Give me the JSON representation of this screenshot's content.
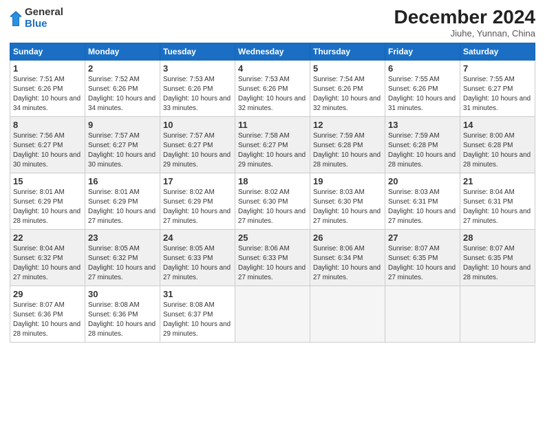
{
  "logo": {
    "general": "General",
    "blue": "Blue"
  },
  "title": "December 2024",
  "location": "Jiuhe, Yunnan, China",
  "days_of_week": [
    "Sunday",
    "Monday",
    "Tuesday",
    "Wednesday",
    "Thursday",
    "Friday",
    "Saturday"
  ],
  "weeks": [
    [
      {
        "num": "1",
        "rise": "7:51 AM",
        "set": "6:26 PM",
        "daylight": "10 hours and 34 minutes."
      },
      {
        "num": "2",
        "rise": "7:52 AM",
        "set": "6:26 PM",
        "daylight": "10 hours and 34 minutes."
      },
      {
        "num": "3",
        "rise": "7:53 AM",
        "set": "6:26 PM",
        "daylight": "10 hours and 33 minutes."
      },
      {
        "num": "4",
        "rise": "7:53 AM",
        "set": "6:26 PM",
        "daylight": "10 hours and 32 minutes."
      },
      {
        "num": "5",
        "rise": "7:54 AM",
        "set": "6:26 PM",
        "daylight": "10 hours and 32 minutes."
      },
      {
        "num": "6",
        "rise": "7:55 AM",
        "set": "6:26 PM",
        "daylight": "10 hours and 31 minutes."
      },
      {
        "num": "7",
        "rise": "7:55 AM",
        "set": "6:27 PM",
        "daylight": "10 hours and 31 minutes."
      }
    ],
    [
      {
        "num": "8",
        "rise": "7:56 AM",
        "set": "6:27 PM",
        "daylight": "10 hours and 30 minutes."
      },
      {
        "num": "9",
        "rise": "7:57 AM",
        "set": "6:27 PM",
        "daylight": "10 hours and 30 minutes."
      },
      {
        "num": "10",
        "rise": "7:57 AM",
        "set": "6:27 PM",
        "daylight": "10 hours and 29 minutes."
      },
      {
        "num": "11",
        "rise": "7:58 AM",
        "set": "6:27 PM",
        "daylight": "10 hours and 29 minutes."
      },
      {
        "num": "12",
        "rise": "7:59 AM",
        "set": "6:28 PM",
        "daylight": "10 hours and 28 minutes."
      },
      {
        "num": "13",
        "rise": "7:59 AM",
        "set": "6:28 PM",
        "daylight": "10 hours and 28 minutes."
      },
      {
        "num": "14",
        "rise": "8:00 AM",
        "set": "6:28 PM",
        "daylight": "10 hours and 28 minutes."
      }
    ],
    [
      {
        "num": "15",
        "rise": "8:01 AM",
        "set": "6:29 PM",
        "daylight": "10 hours and 28 minutes."
      },
      {
        "num": "16",
        "rise": "8:01 AM",
        "set": "6:29 PM",
        "daylight": "10 hours and 27 minutes."
      },
      {
        "num": "17",
        "rise": "8:02 AM",
        "set": "6:29 PM",
        "daylight": "10 hours and 27 minutes."
      },
      {
        "num": "18",
        "rise": "8:02 AM",
        "set": "6:30 PM",
        "daylight": "10 hours and 27 minutes."
      },
      {
        "num": "19",
        "rise": "8:03 AM",
        "set": "6:30 PM",
        "daylight": "10 hours and 27 minutes."
      },
      {
        "num": "20",
        "rise": "8:03 AM",
        "set": "6:31 PM",
        "daylight": "10 hours and 27 minutes."
      },
      {
        "num": "21",
        "rise": "8:04 AM",
        "set": "6:31 PM",
        "daylight": "10 hours and 27 minutes."
      }
    ],
    [
      {
        "num": "22",
        "rise": "8:04 AM",
        "set": "6:32 PM",
        "daylight": "10 hours and 27 minutes."
      },
      {
        "num": "23",
        "rise": "8:05 AM",
        "set": "6:32 PM",
        "daylight": "10 hours and 27 minutes."
      },
      {
        "num": "24",
        "rise": "8:05 AM",
        "set": "6:33 PM",
        "daylight": "10 hours and 27 minutes."
      },
      {
        "num": "25",
        "rise": "8:06 AM",
        "set": "6:33 PM",
        "daylight": "10 hours and 27 minutes."
      },
      {
        "num": "26",
        "rise": "8:06 AM",
        "set": "6:34 PM",
        "daylight": "10 hours and 27 minutes."
      },
      {
        "num": "27",
        "rise": "8:07 AM",
        "set": "6:35 PM",
        "daylight": "10 hours and 27 minutes."
      },
      {
        "num": "28",
        "rise": "8:07 AM",
        "set": "6:35 PM",
        "daylight": "10 hours and 28 minutes."
      }
    ],
    [
      {
        "num": "29",
        "rise": "8:07 AM",
        "set": "6:36 PM",
        "daylight": "10 hours and 28 minutes."
      },
      {
        "num": "30",
        "rise": "8:08 AM",
        "set": "6:36 PM",
        "daylight": "10 hours and 28 minutes."
      },
      {
        "num": "31",
        "rise": "8:08 AM",
        "set": "6:37 PM",
        "daylight": "10 hours and 29 minutes."
      },
      null,
      null,
      null,
      null
    ]
  ]
}
